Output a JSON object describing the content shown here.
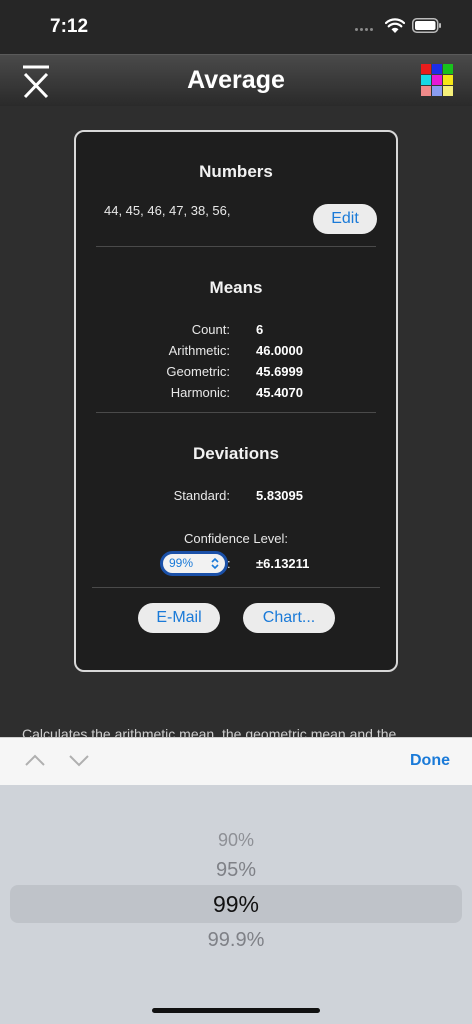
{
  "status": {
    "time": "7:12"
  },
  "nav": {
    "title": "Average"
  },
  "numbers": {
    "title": "Numbers",
    "list": "44, 45, 46, 47, 38, 56,",
    "edit_label": "Edit"
  },
  "means": {
    "title": "Means",
    "rows": [
      {
        "label": "Count:",
        "value": "6"
      },
      {
        "label": "Arithmetic:",
        "value": "46.0000"
      },
      {
        "label": "Geometric:",
        "value": "45.6999"
      },
      {
        "label": "Harmonic:",
        "value": "45.4070"
      }
    ]
  },
  "deviations": {
    "title": "Deviations",
    "standard_label": "Standard:",
    "standard_value": "5.83095",
    "confidence_label": "Confidence Level:",
    "confidence_selected": "99%",
    "confidence_colon": ":",
    "confidence_value": "±6.13211"
  },
  "actions": {
    "email_label": "E-Mail",
    "chart_label": "Chart..."
  },
  "description": "Calculates the arithmetic mean, the geometric mean and the",
  "toolbar": {
    "done_label": "Done"
  },
  "picker": {
    "options": [
      "90%",
      "95%",
      "99%",
      "99.9%"
    ],
    "selected": "99%"
  },
  "colors": {
    "accent": "#1a7ad8",
    "grid_icon": [
      "#e81c1c",
      "#1c2ee8",
      "#18c21c",
      "#16d8e6",
      "#e618d8",
      "#f5e616",
      "#f08a8a",
      "#8a9cf0",
      "#f5f07a"
    ]
  },
  "icons": {
    "app": "x-bar-icon",
    "menu": "color-grid-icon"
  }
}
